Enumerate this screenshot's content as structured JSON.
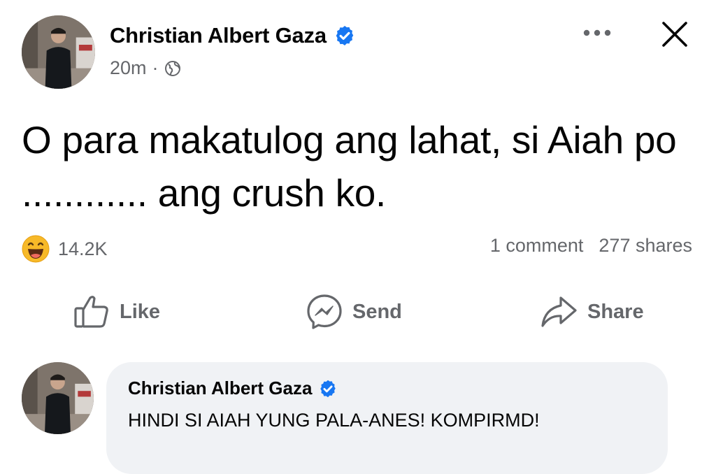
{
  "post": {
    "author": "Christian Albert Gaza",
    "verified": true,
    "time": "20m",
    "separator": "·",
    "audience_icon": "globe-icon",
    "text": "O para makatulog ang lahat, si Aiah po ............ ang crush ko."
  },
  "header_actions": {
    "more_icon": "more-options-icon",
    "close_icon": "close-icon"
  },
  "reactions": {
    "icon": "haha-reaction-icon",
    "count": "14.2K"
  },
  "engagement": {
    "comments": "1 comment",
    "shares": "277 shares"
  },
  "actions": {
    "like": "Like",
    "send": "Send",
    "share": "Share"
  },
  "comment": {
    "author": "Christian Albert Gaza",
    "verified": true,
    "text": "HINDI SI AIAH YUNG PALA-ANES! KOMPIRMD!"
  },
  "colors": {
    "verified_blue": "#1877f2",
    "secondary_text": "#65676b",
    "comment_bg": "#f0f2f5",
    "reaction_yellow": "#f7b928"
  }
}
